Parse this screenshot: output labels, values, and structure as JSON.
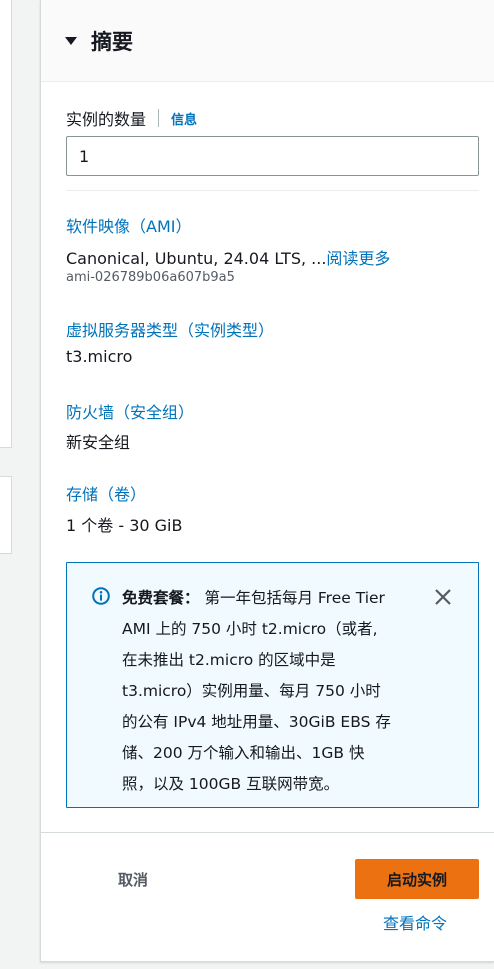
{
  "summary": {
    "title": "摘要"
  },
  "instance_count": {
    "label": "实例的数量",
    "info_link": "信息",
    "value": "1"
  },
  "software_image": {
    "title": "软件映像（AMI）",
    "value": "Canonical, Ubuntu, 24.04 LTS, ...",
    "read_more": "阅读更多",
    "ami_id": "ami-026789b06a607b9a5"
  },
  "instance_type": {
    "title": "虚拟服务器类型（实例类型）",
    "value": "t3.micro"
  },
  "firewall": {
    "title": "防火墙（安全组）",
    "value": "新安全组"
  },
  "storage": {
    "title": "存储（卷）",
    "value": "1 个卷 - 30 GiB"
  },
  "free_tier": {
    "label": "免费套餐：",
    "line1": "第一年包括每月 Free Tier",
    "line2": "AMI 上的 750 小时 t2.micro（或者,",
    "line3": "在未推出 t2.micro 的区域中是",
    "line4": "t3.micro）实例用量、每月 750 小时",
    "line5": "的公有 IPv4 地址用量、30GiB EBS 存",
    "line6": "储、200 万个输入和输出、1GB 快",
    "line7": "照，以及 100GB 互联网带宽。"
  },
  "footer": {
    "cancel": "取消",
    "launch": "启动实例",
    "view_command": "查看命令"
  },
  "colors": {
    "link": "#0073bb",
    "primary_button": "#ec7211",
    "notice_bg": "#f1faff"
  }
}
